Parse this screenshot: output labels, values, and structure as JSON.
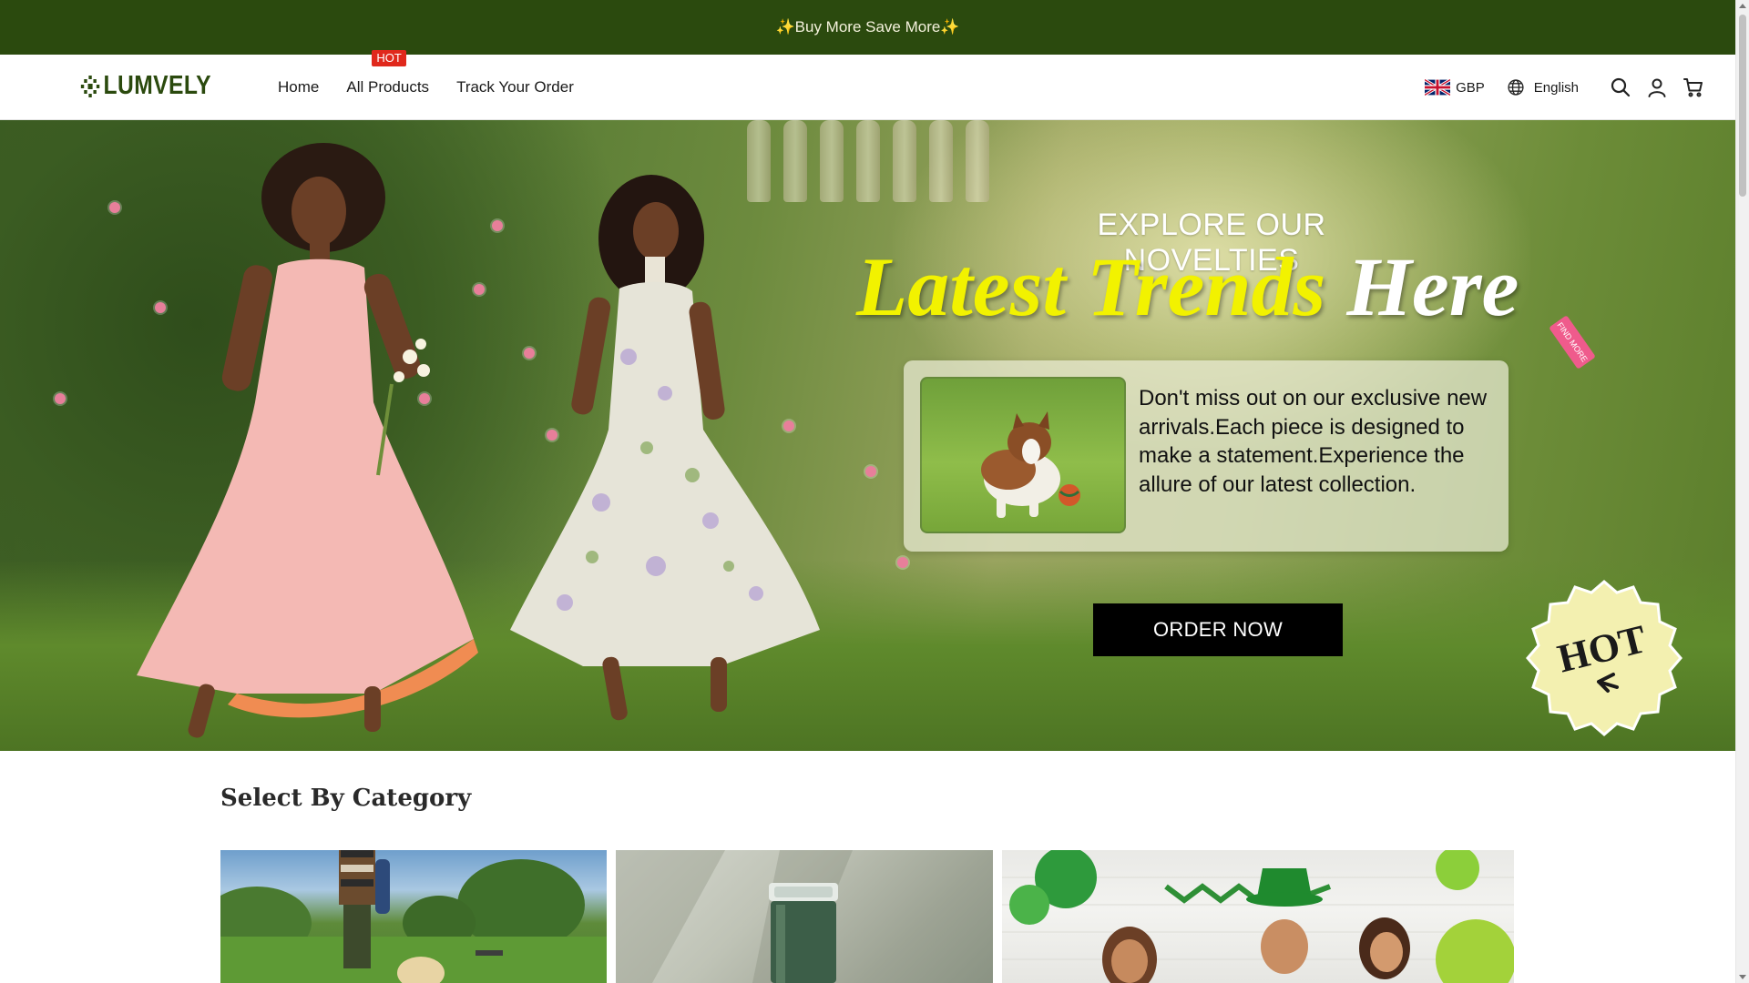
{
  "announcement": {
    "text": "✨Buy More Save More✨"
  },
  "header": {
    "logo": "LUMVELY",
    "nav": [
      {
        "label": "Home"
      },
      {
        "label": "All Products",
        "badge": "HOT"
      },
      {
        "label": "Track Your Order"
      }
    ],
    "currency": "GBP",
    "language": "English",
    "icons": [
      "uk-flag-icon",
      "globe-icon",
      "search-icon",
      "account-icon",
      "cart-icon"
    ]
  },
  "hero": {
    "subtitle": "EXPLORE OUR NOVELTIES",
    "title_part1": "Latest Trends",
    "title_part2": "Here",
    "tag": "FIND MORE",
    "description": "Don't miss out on our exclusive new arrivals.Each piece is designed to make a statement.Experience the allure of our latest collection.",
    "cta": "ORDER NOW",
    "badge": "HOT"
  },
  "category_section": {
    "title": "Select By Category"
  },
  "colors": {
    "announcement_bg": "#2b4a0e",
    "brand": "#2b4a0e",
    "hot_red": "#e0281c",
    "title_yellow": "#f2f200",
    "badge_yellow": "#f3f0b0"
  }
}
